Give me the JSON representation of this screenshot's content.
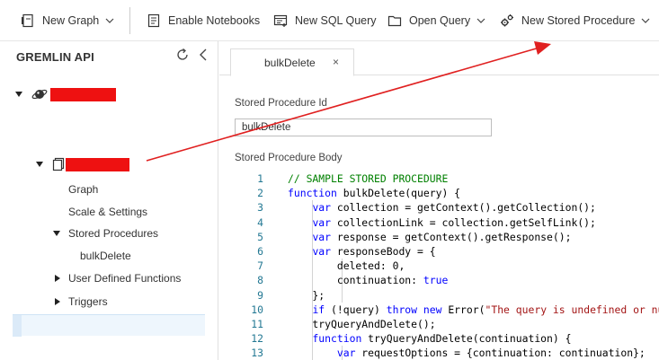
{
  "toolbar": {
    "new_graph": "New Graph",
    "enable_notebooks": "Enable Notebooks",
    "new_sql_query": "New SQL Query",
    "open_query": "Open Query",
    "new_stored_procedure": "New Stored Procedure"
  },
  "sidebar": {
    "title": "GREMLIN API",
    "items": {
      "graph": "Graph",
      "scale_settings": "Scale & Settings",
      "stored_procedures": "Stored Procedures",
      "bulk_delete": "bulkDelete",
      "udf": "User Defined Functions",
      "triggers": "Triggers"
    }
  },
  "tab": {
    "label": "bulkDelete",
    "close": "×"
  },
  "form": {
    "id_label": "Stored Procedure Id",
    "id_value": "bulkDelete",
    "body_label": "Stored Procedure Body"
  },
  "editor": {
    "lines": [
      {
        "n": "1",
        "text": "// SAMPLE STORED PROCEDURE"
      },
      {
        "n": "2",
        "text": "function bulkDelete(query) {"
      },
      {
        "n": "3",
        "text": "    var collection = getContext().getCollection();"
      },
      {
        "n": "4",
        "text": "    var collectionLink = collection.getSelfLink();"
      },
      {
        "n": "5",
        "text": "    var response = getContext().getResponse();"
      },
      {
        "n": "6",
        "text": "    var responseBody = {"
      },
      {
        "n": "7",
        "text": "        deleted: 0,"
      },
      {
        "n": "8",
        "text": "        continuation: true"
      },
      {
        "n": "9",
        "text": "    };"
      },
      {
        "n": "10",
        "text": "    if (!query) throw new Error(\"The query is undefined or nul"
      },
      {
        "n": "11",
        "text": "    tryQueryAndDelete();"
      },
      {
        "n": "12",
        "text": "    function tryQueryAndDelete(continuation) {"
      },
      {
        "n": "13",
        "text": "        var requestOptions = {continuation: continuation};"
      }
    ]
  },
  "colors": {
    "annotation_arrow": "#e02020",
    "redaction": "#ee1111",
    "line_number": "#237893",
    "comment": "#008000",
    "keyword": "#0000ff",
    "string": "#a31515"
  },
  "icons": [
    "new-graph-icon",
    "notebook-icon",
    "sql-query-icon",
    "open-query-icon",
    "stored-procedure-icon",
    "refresh-icon",
    "collapse-icon",
    "planet-icon",
    "collection-icon"
  ]
}
